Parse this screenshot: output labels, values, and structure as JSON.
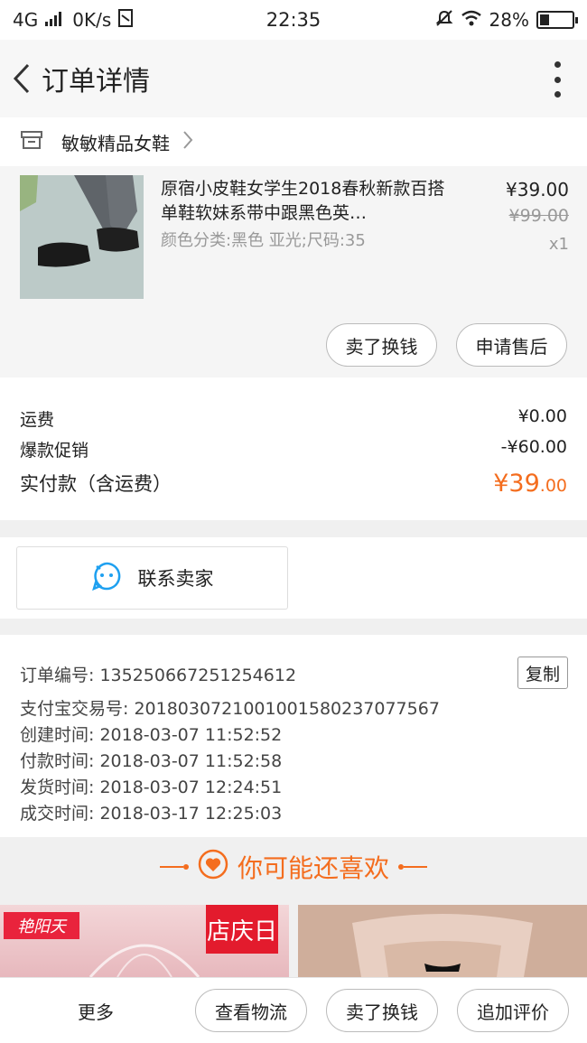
{
  "status_bar": {
    "network": "4G",
    "speed": "0K/s",
    "time": "22:35",
    "battery": "28%",
    "battery_level": 0.28
  },
  "header": {
    "title": "订单详情"
  },
  "shop": {
    "name": "敏敏精品女鞋"
  },
  "product": {
    "name": "原宿小皮鞋女学生2018春秋新款百搭单鞋软妹系带中跟黑色英…",
    "sku": "颜色分类:黑色  亚光;尺码:35",
    "price": "¥39.00",
    "original_price": "¥99.00",
    "quantity": "x1",
    "sell_button": "卖了换钱",
    "after_sale_button": "申请售后"
  },
  "fees": {
    "shipping_label": "运费",
    "shipping_value": "¥0.00",
    "promo_label": "爆款促销",
    "promo_value": "-¥60.00",
    "total_label": "实付款（含运费）",
    "total_currency": "¥",
    "total_int": "39",
    "total_dec": ".00"
  },
  "contact": {
    "label": "联系卖家"
  },
  "order_info": {
    "order_no": "订单编号: 135250667251254612",
    "alipay_no": "支付宝交易号: 2018030721001001580237077567",
    "created": "创建时间: 2018-03-07 11:52:52",
    "paid": "付款时间: 2018-03-07 11:52:58",
    "shipped": "发货时间: 2018-03-07 12:24:51",
    "completed": "成交时间: 2018-03-17 12:25:03",
    "copy_button": "复制"
  },
  "recommend": {
    "title": "你可能还喜欢",
    "left_brand": "艳阳天",
    "left_promo": "店庆日"
  },
  "bottom_bar": {
    "more": "更多",
    "logistics": "查看物流",
    "sell": "卖了换钱",
    "review": "追加评价"
  }
}
